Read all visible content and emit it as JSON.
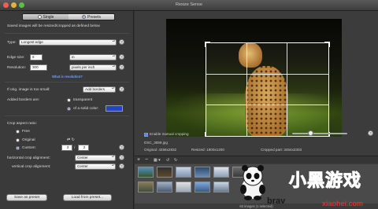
{
  "window": {
    "title": "Resize Sense"
  },
  "tabs": [
    {
      "label": "Single",
      "selected": false
    },
    {
      "label": "Presets",
      "selected": true
    }
  ],
  "settings": {
    "intro": "Saved images will be resized/cropped as defined below",
    "type_label": "Type:",
    "type_value": "Longest edge",
    "edge_size_label": "Edge size:",
    "edge_size_value": "6",
    "edge_size_unit": "in",
    "resolution_label": "Resolution:",
    "resolution_value": "300",
    "resolution_unit": "pixels per inch",
    "resolution_link": "What is resolution?",
    "small_label": "If orig. image is too small:",
    "small_value": "Add borders",
    "borders_label": "Added borders are:",
    "borders_opt1": "transparent",
    "borders_opt2": "of a solid color:",
    "border_color": "#1f45c8",
    "crop_label": "Crop aspect ratio:",
    "crop_free": "Free",
    "crop_original": "Original",
    "crop_custom": "Custom:",
    "crop_w": "3",
    "crop_h": "2",
    "halign_label": "horizontal crop alignment:",
    "halign_value": "Center",
    "valign_label": "vertical crop alignment:",
    "valign_value": "Center",
    "save_preset": "Save as preset",
    "load_preset": "Load from preset..."
  },
  "preview": {
    "manual_crop_label": "Enable manual cropping",
    "filename": "DSC_3859.jpg",
    "original": "Original: 4256x2832",
    "resized": "Resized: 1800x1200",
    "cropped": "Cropped part: 3454x2303",
    "status": "63 images (1 selected)"
  },
  "watermark": {
    "brand": "小黑游戏",
    "site": "xiaohei.com",
    "partial": "brav"
  }
}
